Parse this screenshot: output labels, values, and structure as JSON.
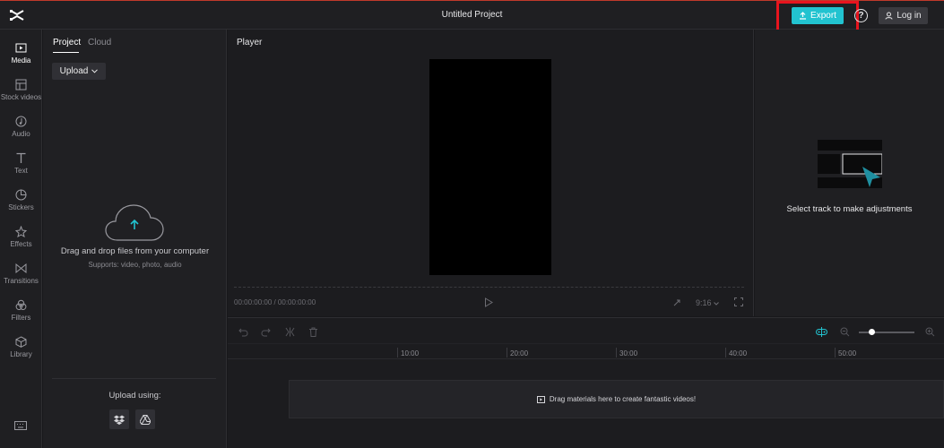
{
  "app": {
    "project_title": "Untitled Project",
    "export_label": "Export",
    "login_label": "Log in",
    "accent_color": "#22c3d0",
    "highlight_color": "#e8141e"
  },
  "rail": {
    "items": [
      {
        "label": "Media",
        "icon": "media-icon"
      },
      {
        "label": "Stock videos",
        "icon": "stock-videos-icon"
      },
      {
        "label": "Audio",
        "icon": "audio-icon"
      },
      {
        "label": "Text",
        "icon": "text-icon"
      },
      {
        "label": "Stickers",
        "icon": "stickers-icon"
      },
      {
        "label": "Effects",
        "icon": "effects-icon"
      },
      {
        "label": "Transitions",
        "icon": "transitions-icon"
      },
      {
        "label": "Filters",
        "icon": "filters-icon"
      },
      {
        "label": "Library",
        "icon": "library-icon"
      }
    ],
    "active": "Media"
  },
  "media_panel": {
    "tabs": [
      "Project",
      "Cloud"
    ],
    "upload_label": "Upload",
    "drag_text": "Drag and drop files from your computer",
    "supports_text": "Supports: video, photo, audio",
    "upload_using": "Upload using:"
  },
  "player": {
    "title": "Player",
    "timecode": "00:00:00:00 / 00:00:00:00",
    "ratio": "9:16"
  },
  "right_panel": {
    "message": "Select track to make adjustments"
  },
  "timeline": {
    "ruler": [
      "10:00",
      "20:00",
      "30:00",
      "40:00",
      "50:00"
    ],
    "drop_text": "Drag materials here to create fantastic videos!"
  }
}
